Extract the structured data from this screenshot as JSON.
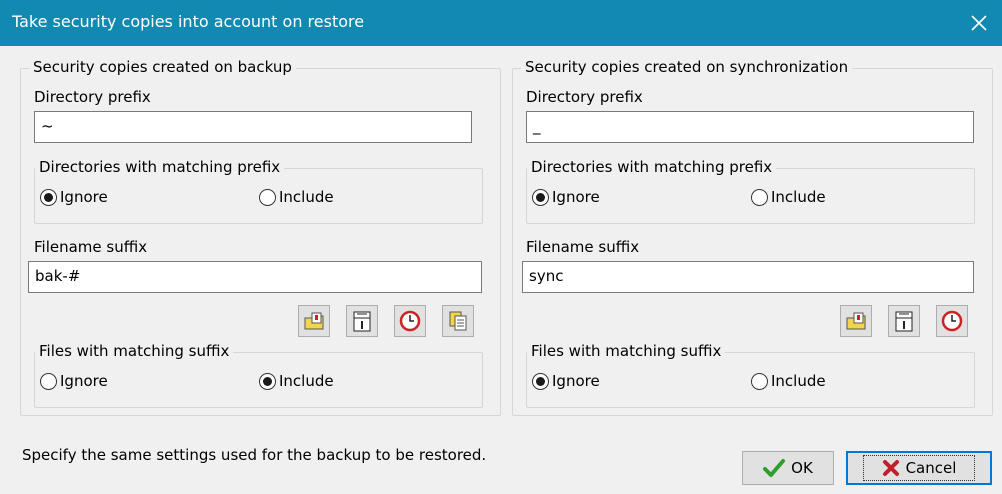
{
  "window": {
    "title": "Take security copies into account on restore"
  },
  "left": {
    "legend": "Security copies created on backup",
    "dir_prefix_label": "Directory prefix",
    "dir_prefix_value": "~",
    "dir_matching_legend": "Directories with matching prefix",
    "dir_ignore": "Ignore",
    "dir_include": "Include",
    "dir_selected": "Ignore",
    "suffix_label": "Filename suffix",
    "suffix_value": "bak-#",
    "files_matching_legend": "Files with matching suffix",
    "files_ignore": "Ignore",
    "files_include": "Include",
    "files_selected": "Include",
    "icons": [
      "folder-date-icon",
      "calendar-icon",
      "clock-icon",
      "copy-icon"
    ]
  },
  "right": {
    "legend": "Security copies created on synchronization",
    "dir_prefix_label": "Directory prefix",
    "dir_prefix_value": "_",
    "dir_matching_legend": "Directories with matching prefix",
    "dir_ignore": "Ignore",
    "dir_include": "Include",
    "dir_selected": "Ignore",
    "suffix_label": "Filename suffix",
    "suffix_value": "sync",
    "files_matching_legend": "Files with matching suffix",
    "files_ignore": "Ignore",
    "files_include": "Include",
    "files_selected": "Ignore",
    "icons": [
      "folder-date-icon",
      "calendar-icon",
      "clock-icon"
    ]
  },
  "footer": {
    "hint": "Specify the same settings used for the backup to be restored.",
    "ok_label": "OK",
    "cancel_label": "Cancel"
  },
  "colors": {
    "titlebar": "#1189b0",
    "ok_check": "#2e9e2e",
    "cancel_x": "#c0202c",
    "focus_border": "#0078d7"
  }
}
